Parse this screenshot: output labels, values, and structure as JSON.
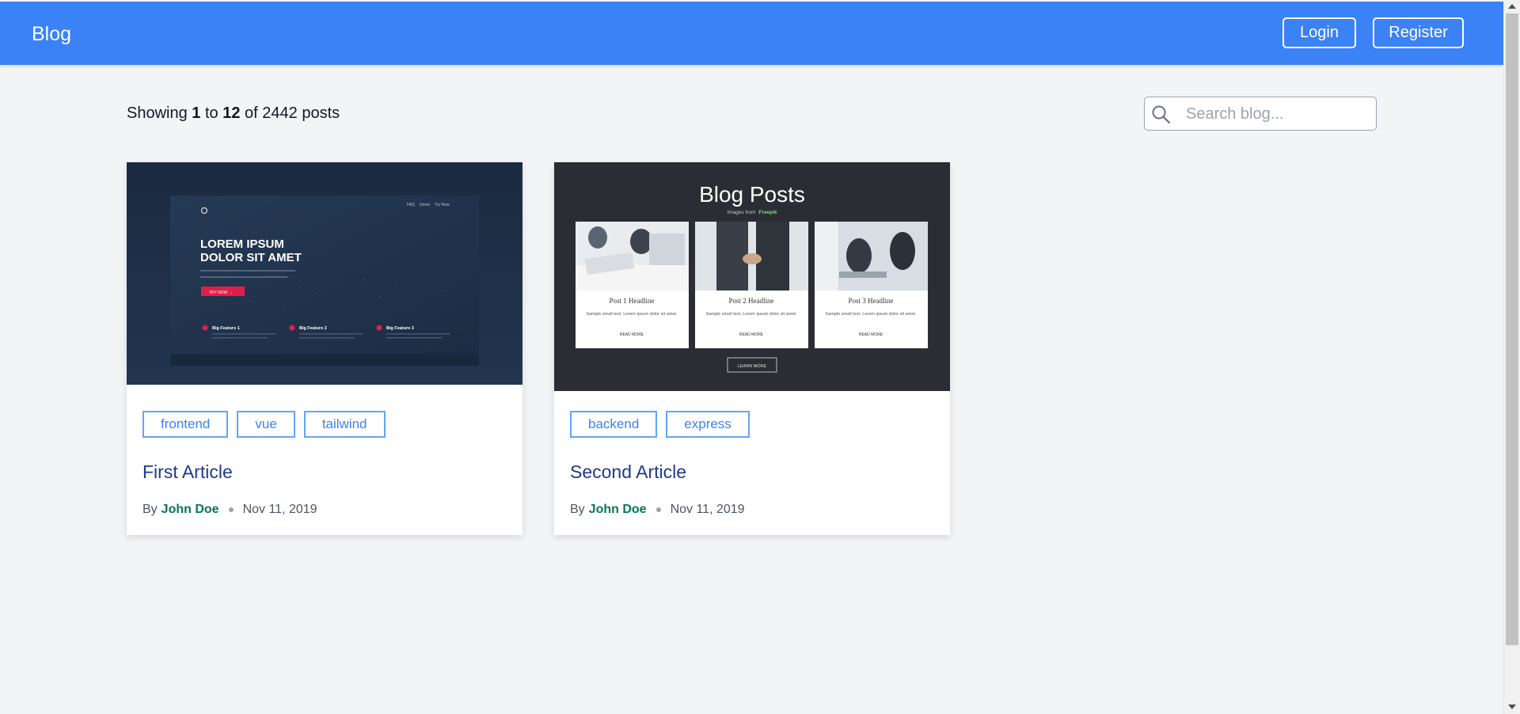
{
  "header": {
    "brand": "Blog",
    "login_label": "Login",
    "register_label": "Register"
  },
  "summary": {
    "prefix": "Showing",
    "from": "1",
    "to_word": "to",
    "to": "12",
    "of_text": "of 2442 posts"
  },
  "search": {
    "placeholder": "Search blog..."
  },
  "posts": [
    {
      "title": "First Article",
      "tags": [
        "frontend",
        "vue",
        "tailwind"
      ],
      "by": "By",
      "author": "John Doe",
      "date": "Nov 11, 2019",
      "image": {
        "headline_line1": "LOREM IPSUM",
        "headline_line2": "DOLOR SIT AMET",
        "nav_items": [
          "FAQ",
          "Demo",
          "Try Now"
        ],
        "button": "TRY NOW →",
        "features": [
          "Big Feature 1",
          "Big Feature 2",
          "Big Feature 3"
        ]
      }
    },
    {
      "title": "Second Article",
      "tags": [
        "backend",
        "express"
      ],
      "by": "By",
      "author": "John Doe",
      "date": "Nov 11, 2019",
      "image": {
        "title": "Blog Posts",
        "subtitle_prefix": "Images from",
        "subtitle_brand": "Freepik",
        "posts": [
          "Post 1 Headline",
          "Post 2 Headline",
          "Post 3 Headline"
        ],
        "post_text": "Sample small text. Lorem ipsum dolor sit amet.",
        "read_more": "READ MORE",
        "learn_more": "LEARN MORE"
      }
    }
  ],
  "colors": {
    "header": "#3b82f6",
    "tag_border": "#60a5fa",
    "title": "#1e3a8a",
    "author": "#047857",
    "background": "#f3f4f6"
  }
}
